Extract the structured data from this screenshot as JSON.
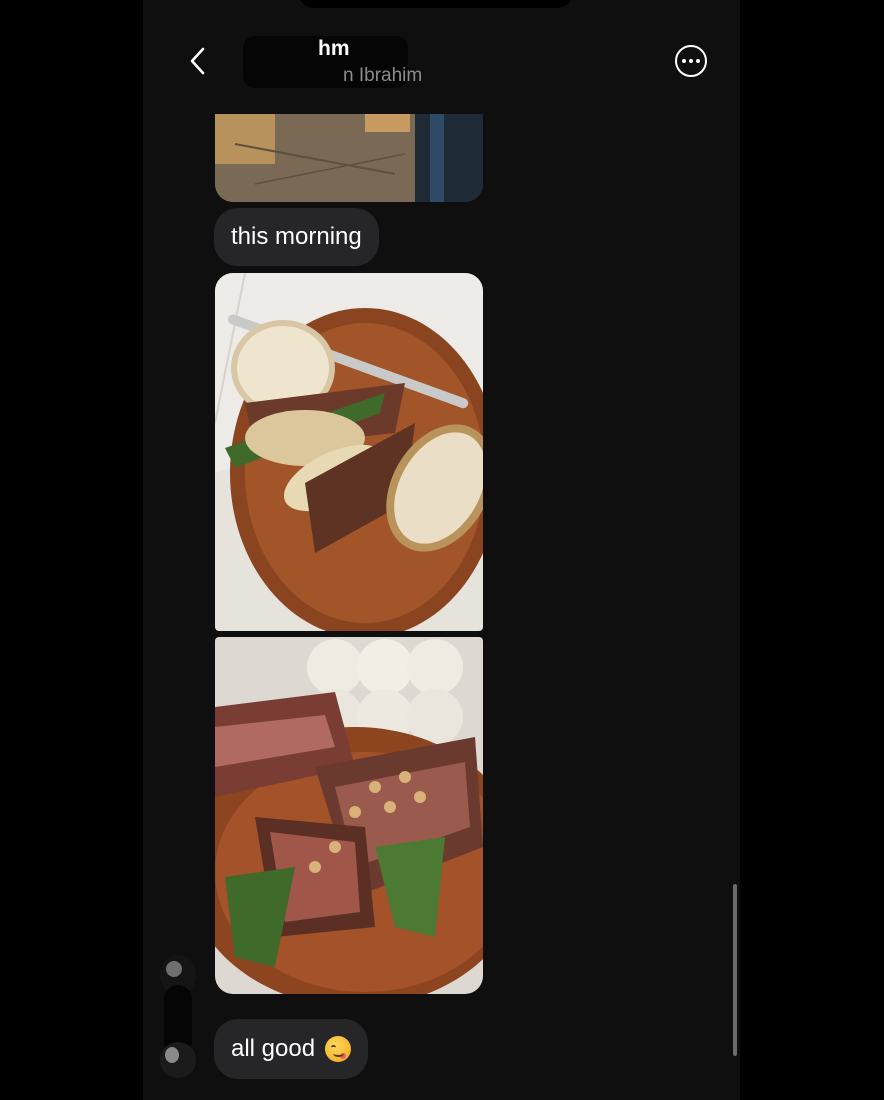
{
  "header": {
    "title": "hm",
    "subtitle": "n Ibrahim",
    "back_icon": "chevron-left-icon",
    "more_icon": "more-options-icon"
  },
  "messages": [
    {
      "type": "image",
      "description": "bread-on-cutting-board"
    },
    {
      "type": "text",
      "text": "this morning"
    },
    {
      "type": "image",
      "description": "steak-sandwich-on-wooden-board"
    },
    {
      "type": "image",
      "description": "sliced-steak-with-mushrooms"
    },
    {
      "type": "text",
      "text": "all good",
      "emoji": "drooling-face-emoji"
    }
  ],
  "colors": {
    "background": "#0f0f10",
    "bubble": "#262628",
    "subtitle": "#8c8c8c"
  }
}
